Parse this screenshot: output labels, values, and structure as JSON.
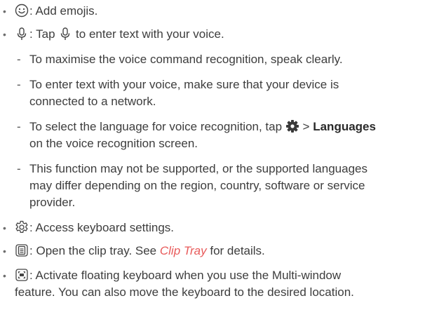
{
  "bullets": [
    {
      "icon": "emoji-icon",
      "text": "Add emojis."
    },
    {
      "icon": "microphone-icon",
      "pre": "Tap",
      "post": "to enter text with your voice.",
      "subitems": [
        {
          "text": "To maximise the voice command recognition, speak clearly."
        },
        {
          "line1": "To enter text with your voice, make sure that your device is",
          "line2": "connected to a network."
        },
        {
          "pre": "To select the language for voice recognition, tap",
          "bold": "Languages",
          "line2": "on the voice recognition screen."
        },
        {
          "line1": "This function may not be supported, or the supported languages",
          "line2": "may differ depending on the region, country, software or service",
          "line3": "provider."
        }
      ]
    },
    {
      "icon": "gear-settings-icon",
      "text": "Access keyboard settings."
    },
    {
      "icon": "clip-tray-icon",
      "pre": "Open the clip tray. See",
      "link": "Clip Tray",
      "post": "for details."
    },
    {
      "icon": "floating-keyboard-icon",
      "line1": "Activate floating keyboard when you use the Multi-window",
      "line2": "feature. You can also move the keyboard to the desired location."
    }
  ],
  "separators": {
    "colon": ":",
    "gt": ">",
    "bullet": "•",
    "dash": "-"
  }
}
